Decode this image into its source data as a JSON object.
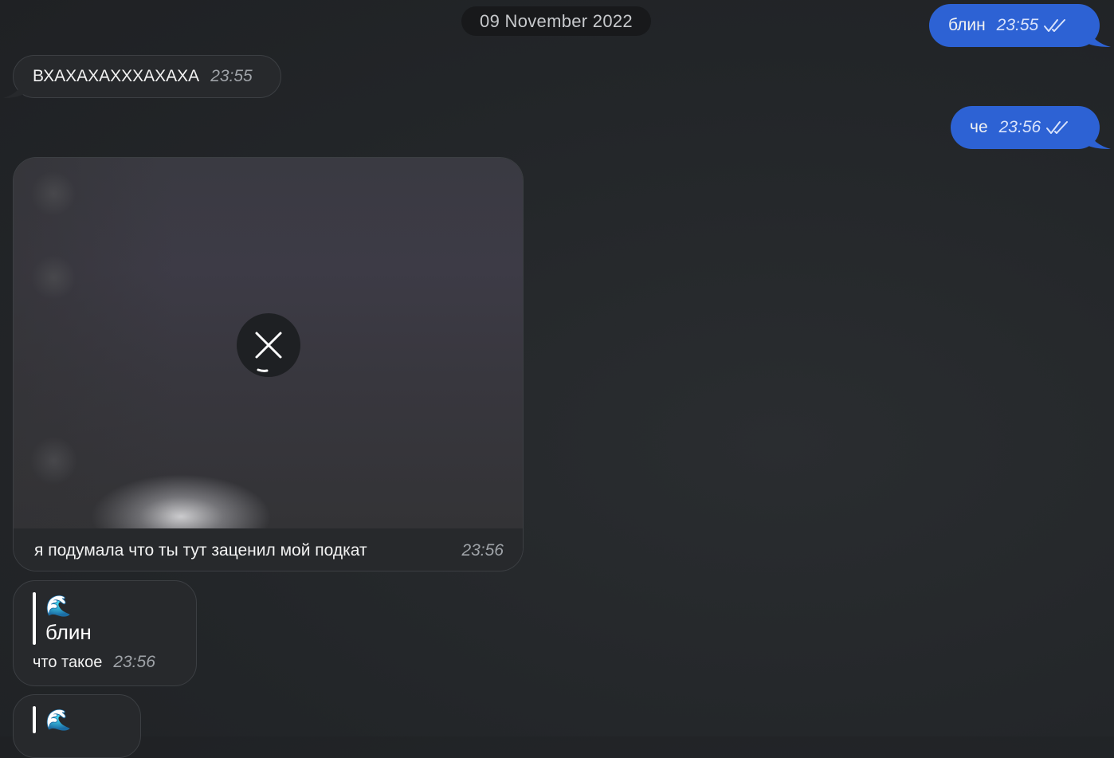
{
  "date_separator": "09 November 2022",
  "messages": [
    {
      "direction": "outgoing",
      "text": "блин",
      "time": "23:55",
      "status": "read-double-check"
    },
    {
      "direction": "incoming",
      "text": "ВХАХАХАХХХАХАХА",
      "time": "23:55"
    },
    {
      "direction": "outgoing",
      "text": "че",
      "time": "23:56",
      "status": "read-double-check"
    },
    {
      "direction": "incoming",
      "type": "media",
      "caption": "я подумала что ты тут заценил мой подкат",
      "time": "23:56",
      "media_state": "loading",
      "overlay_icon": "close-icon"
    },
    {
      "direction": "incoming",
      "type": "reply",
      "quote_emoji": "🌊",
      "quote_text": "блин",
      "text": "что такое",
      "time": "23:56"
    },
    {
      "direction": "incoming",
      "type": "reply",
      "quote_emoji": "🌊"
    }
  ],
  "colors": {
    "outgoing_bubble": "#2d62d4",
    "incoming_bubble": "#27292c",
    "background": "#232629"
  }
}
